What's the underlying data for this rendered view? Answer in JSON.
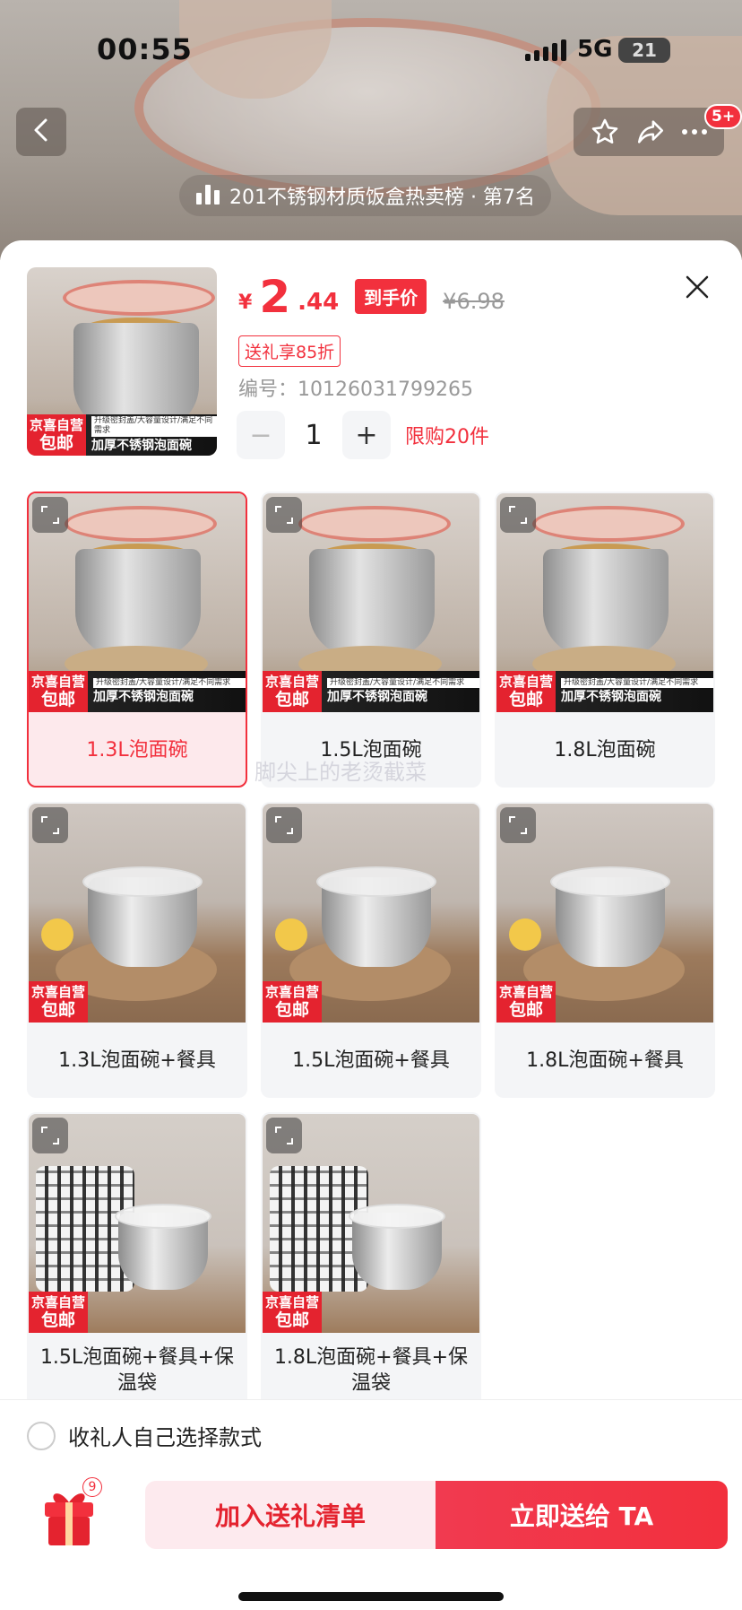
{
  "status_bar": {
    "time": "00:55",
    "network": "5G",
    "battery": "21"
  },
  "nav": {
    "badge": "5+",
    "rank_text": "201不锈钢材质饭盒热卖榜 · 第7名"
  },
  "product": {
    "price_symbol": "¥",
    "price_int": "2",
    "price_dec": ".44",
    "price_tag": "到手价",
    "original_price": "¥6.98",
    "discount": "送礼享85折",
    "sku": "编号：10126031799265",
    "quantity": "1",
    "limit": "限购20件",
    "thumb_promo": {
      "tag_top": "京喜自营",
      "tag_bottom": "包邮",
      "strip_sub": "升级密封盖/大容量设计/满足不同需求",
      "strip_main": "加厚不锈钢泡面碗"
    }
  },
  "variants": [
    {
      "label": "1.3L泡面碗",
      "selected": true,
      "art": "a"
    },
    {
      "label": "1.5L泡面碗",
      "selected": false,
      "art": "a"
    },
    {
      "label": "1.8L泡面碗",
      "selected": false,
      "art": "a"
    },
    {
      "label": "1.3L泡面碗+餐具",
      "selected": false,
      "art": "b"
    },
    {
      "label": "1.5L泡面碗+餐具",
      "selected": false,
      "art": "b"
    },
    {
      "label": "1.8L泡面碗+餐具",
      "selected": false,
      "art": "b"
    },
    {
      "label": "1.5L泡面碗+餐具+保温袋",
      "selected": false,
      "art": "c"
    },
    {
      "label": "1.8L泡面碗+餐具+保温袋",
      "selected": false,
      "art": "c"
    }
  ],
  "watermark": "脚尖上的老烫截菜",
  "bottom": {
    "radio_label": "收礼人自己选择款式",
    "gift_count": "9",
    "add_button": "加入送礼清单",
    "send_button": "立即送给 TA"
  },
  "colors": {
    "accent": "#f2303d",
    "accent_light": "#fdeaee"
  },
  "icons": [
    "back-chevron-icon",
    "star-icon",
    "share-icon",
    "more-icon",
    "rank-bars-icon",
    "close-icon",
    "expand-icon",
    "gift-box-icon"
  ]
}
